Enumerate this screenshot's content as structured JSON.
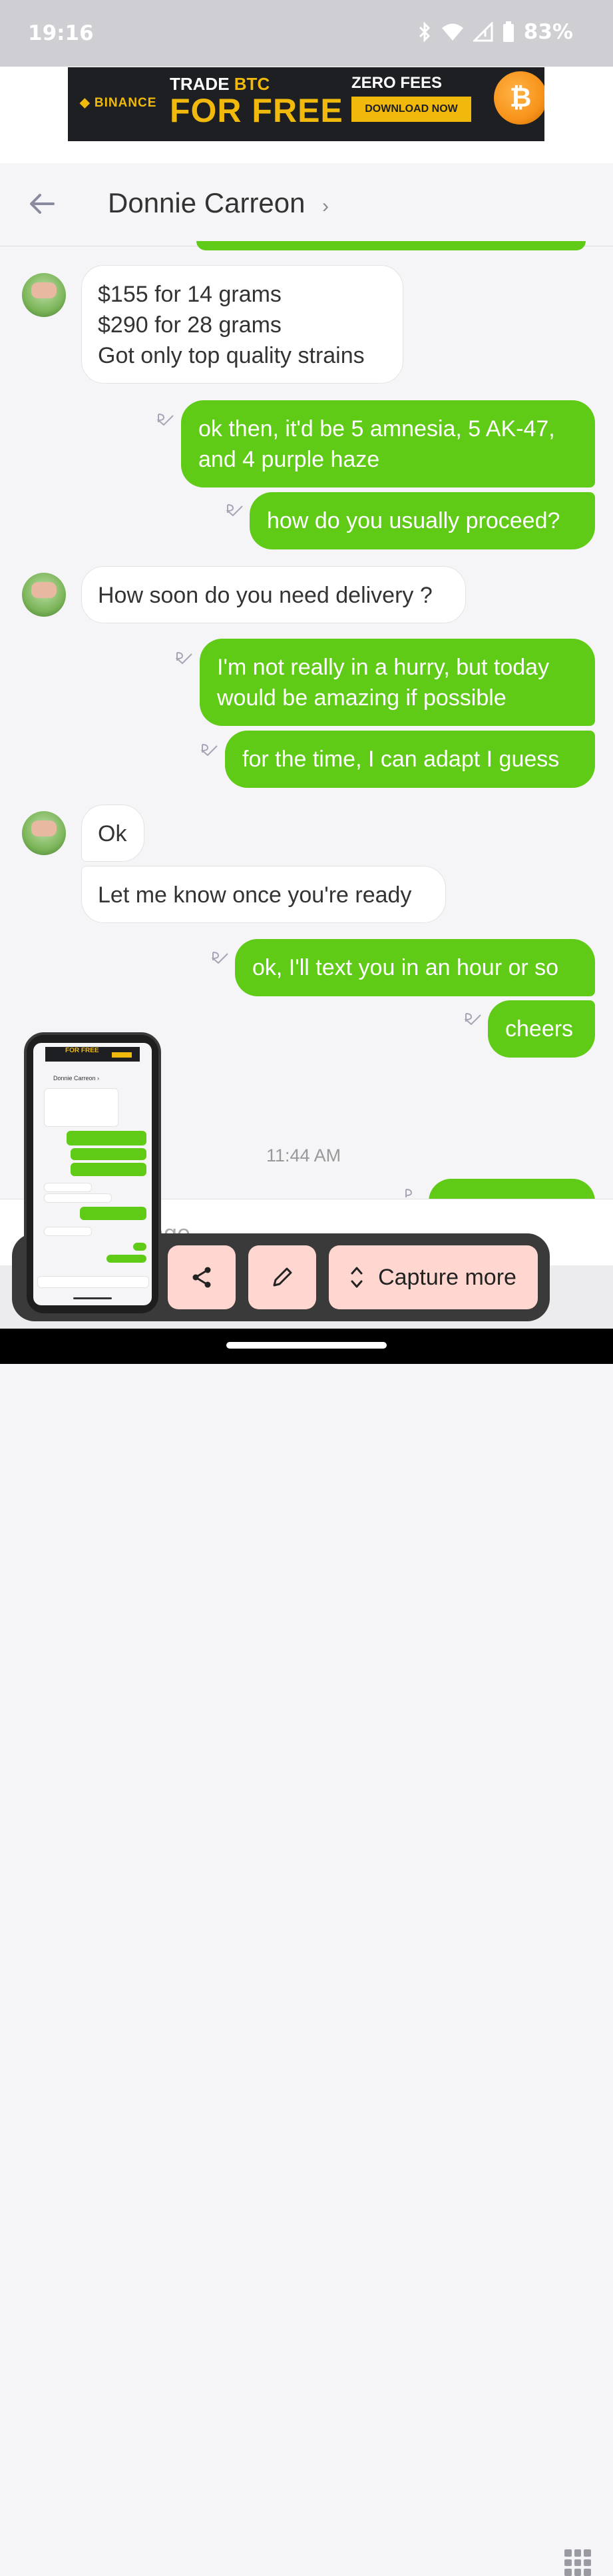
{
  "status": {
    "time": "19:16",
    "battery": "83%"
  },
  "ad": {
    "brand": "BINANCE",
    "trade_prefix": "TRADE ",
    "trade_coin": "BTC",
    "headline": "FOR FREE",
    "zero_fees": "ZERO FEES",
    "cta": "DOWNLOAD NOW",
    "coin_symbol": "₿"
  },
  "header": {
    "contact_name": "Donnie Carreon",
    "chevron": "›"
  },
  "messages": [
    {
      "dir": "in",
      "text": "$155 for 14 grams\n$290 for 28 grams\nGot only top quality strains"
    },
    {
      "dir": "out",
      "text": "ok then, it'd be 5 amnesia, 5 AK-47, and 4 purple haze"
    },
    {
      "dir": "out",
      "text": "how do you usually proceed?"
    },
    {
      "dir": "in",
      "text": "How soon do you need delivery ?"
    },
    {
      "dir": "out",
      "text": "I'm not really in a hurry, but today would be amazing if possible"
    },
    {
      "dir": "out",
      "text": "for the time, I can adapt I guess"
    },
    {
      "dir": "in",
      "text": "Ok"
    },
    {
      "dir": "in",
      "text": "Let me know once you're ready"
    },
    {
      "dir": "out",
      "text": "ok, I'll text you in an hour or so"
    },
    {
      "dir": "out",
      "text": "cheers"
    }
  ],
  "timestamp": "11:44 AM",
  "input": {
    "placeholder": "age"
  },
  "screenshot_toolbar": {
    "capture_more_label": "Capture more"
  },
  "preview": {
    "ad_text": "FOR FREE",
    "title": "Donnie Carreon ›"
  },
  "colors": {
    "outgoing": "#5fcb17",
    "incoming": "#ffffff",
    "toolbar_button": "#ffd7d0"
  }
}
